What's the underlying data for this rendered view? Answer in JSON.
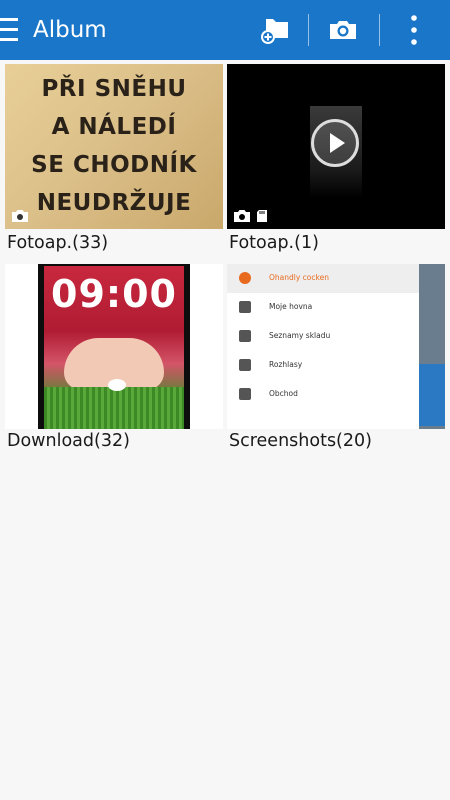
{
  "appbar": {
    "title": "Album",
    "actions": [
      "add-folder-icon",
      "camera-icon",
      "overflow-menu-icon"
    ],
    "color": "#1976c9"
  },
  "albums": [
    {
      "caption": "Fotoap.(33)",
      "thumb_text": [
        "PŘI SNĚHU",
        "A NÁLEDÍ",
        "SE CHODNÍK",
        "NEUDRŽUJE"
      ],
      "badges": [
        "camera-icon"
      ]
    },
    {
      "caption": "Fotoap.(1)",
      "badges": [
        "camera-icon",
        "sd-card-icon"
      ]
    },
    {
      "caption": "Download(32)",
      "thumb_clock": "09:00"
    },
    {
      "caption": "Screenshots(20)",
      "thumb_menu": [
        "Ohandly cocken",
        "Moje hovna",
        "Seznamy skladu",
        "Rozhlasy",
        "Obchod"
      ]
    }
  ]
}
